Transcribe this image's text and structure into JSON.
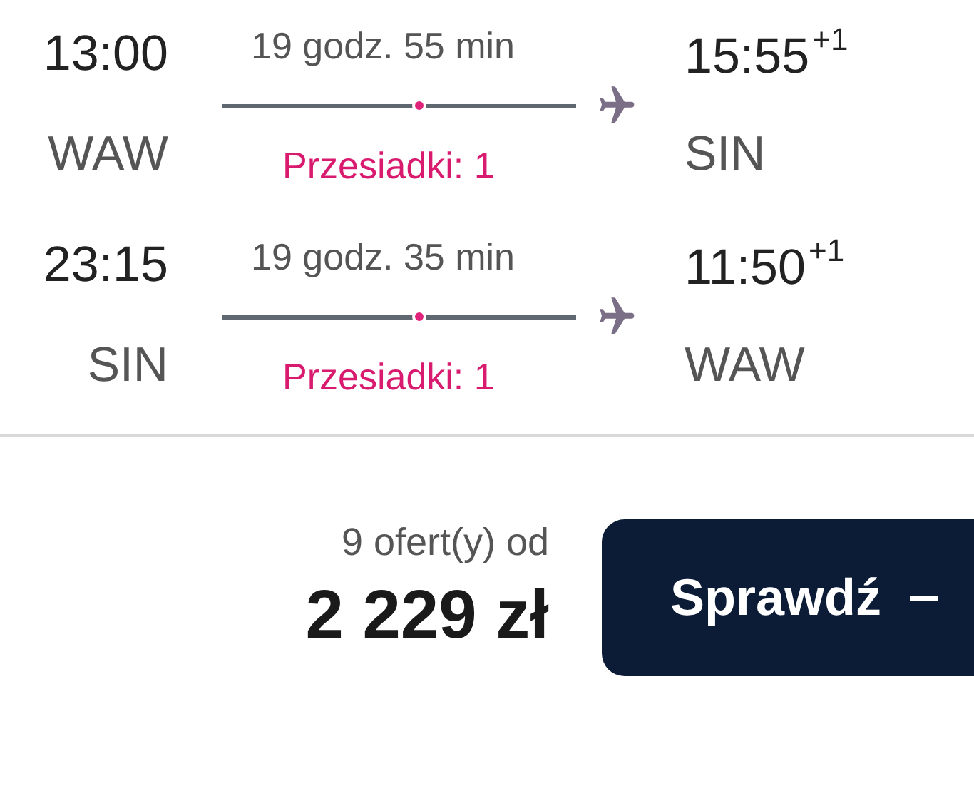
{
  "flights": [
    {
      "dep_time": "13:00",
      "dep_airport": "WAW",
      "duration": "19 godz. 55 min",
      "stops": "Przesiadki: 1",
      "arr_time": "15:55",
      "arr_day_offset": "+1",
      "arr_airport": "SIN"
    },
    {
      "dep_time": "23:15",
      "dep_airport": "SIN",
      "duration": "19 godz. 35 min",
      "stops": "Przesiadki: 1",
      "arr_time": "11:50",
      "arr_day_offset": "+1",
      "arr_airport": "WAW"
    }
  ],
  "offers": "9 ofert(y) od",
  "price": "2 229 zł",
  "button": "Sprawdź"
}
